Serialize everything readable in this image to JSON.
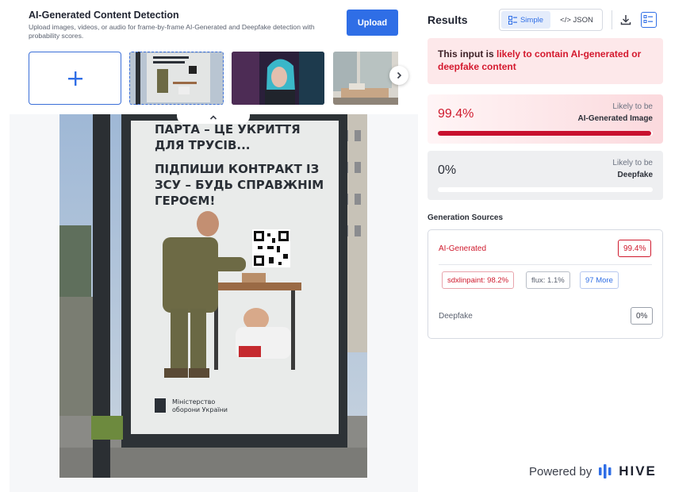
{
  "left": {
    "title": "AI-Generated Content Detection",
    "subtitle": "Upload images, videos, or audio for frame-by-frame AI-Generated and Deepfake detection with probability scores.",
    "upload_label": "Upload",
    "poster": {
      "line1": "ПАРТА – ЦЕ УКРИТТЯ",
      "line2": "ДЛЯ ТРУСІВ...",
      "line3": "ПІДПИШИ КОНТРАКТ ІЗ",
      "line4": "ЗСУ – БУДЬ СПРАВЖНІМ",
      "line5": "ГЕРОЄМ!",
      "ministry1": "Міністерство",
      "ministry2": "оборони України"
    }
  },
  "results": {
    "title": "Results",
    "toggle_simple": "Simple",
    "toggle_json": "</> JSON",
    "verdict_prefix": "This input is ",
    "verdict_highlight": "likely to contain AI-generated or deepfake content",
    "ai_score": "99.4%",
    "ai_score_fraction": 0.994,
    "ai_label1": "Likely to be",
    "ai_label2": "AI-Generated Image",
    "df_score": "0%",
    "df_score_fraction": 0.0,
    "df_label1": "Likely to be",
    "df_label2": "Deepfake",
    "gen_title": "Generation Sources",
    "gen_ai_label": "AI-Generated",
    "gen_ai_badge": "99.4%",
    "chip1": "sdxlinpaint: 98.2%",
    "chip2": "flux: 1.1%",
    "chip3": "97 More",
    "gen_df_label": "Deepfake",
    "gen_df_badge": "0%",
    "powered_by": "Powered by",
    "brand": "HIVE"
  },
  "colors": {
    "accent": "#2f6ee6",
    "danger": "#cf1a2d",
    "verdict_bg": "#fde8ea"
  },
  "icons": [
    "plus-icon",
    "chevron-right-icon",
    "chevron-up-icon",
    "simple-view-icon",
    "download-icon",
    "list-view-icon",
    "hive-logo-icon"
  ]
}
